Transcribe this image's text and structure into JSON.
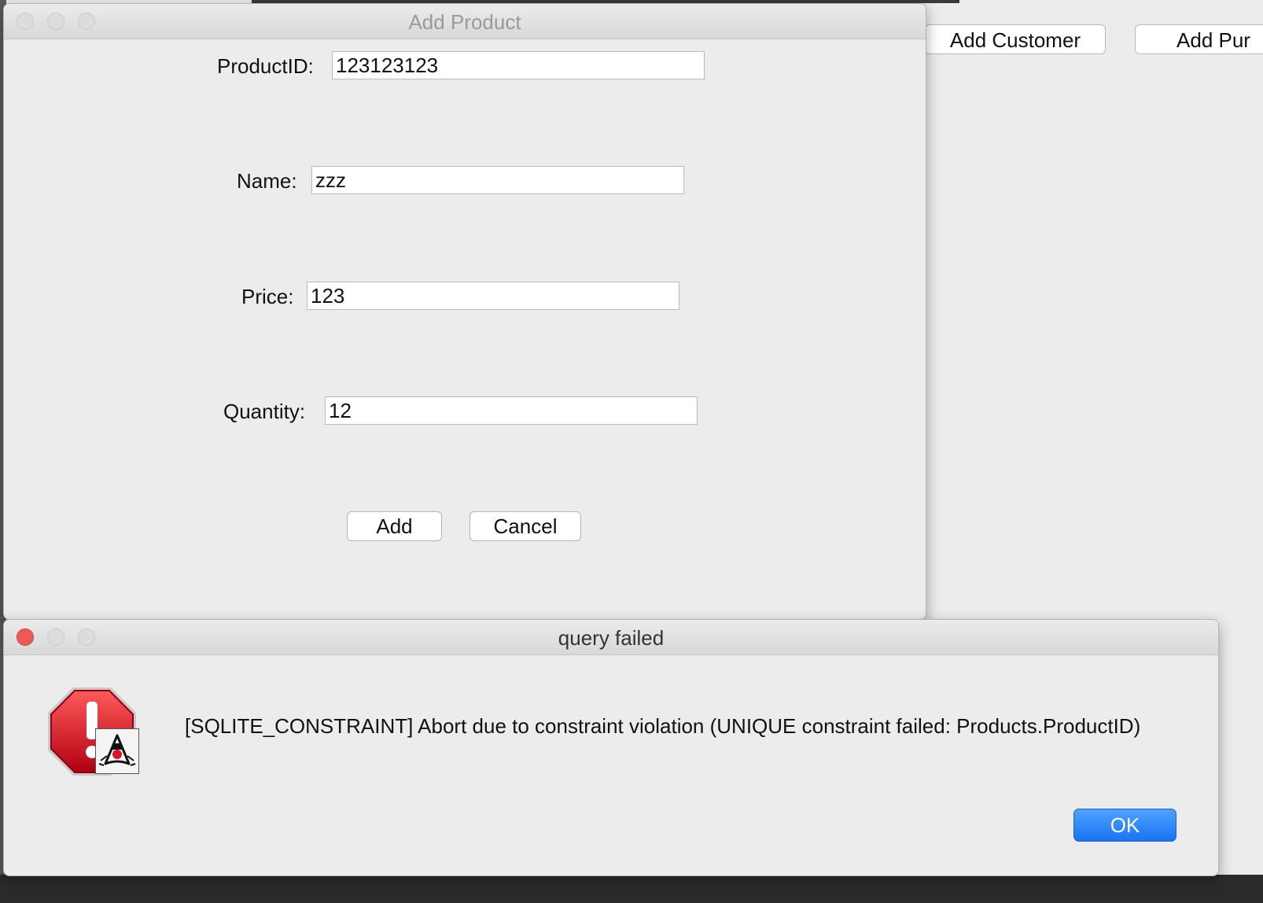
{
  "background_window": {
    "buttons": [
      "Add Customer",
      "Add Pur"
    ]
  },
  "add_product_dialog": {
    "title": "Add Product",
    "fields": [
      {
        "label": "ProductID:",
        "value": "123123123"
      },
      {
        "label": "Name:",
        "value": "zzz"
      },
      {
        "label": "Price:",
        "value": "123"
      },
      {
        "label": "Quantity:",
        "value": "12"
      }
    ],
    "add_label": "Add",
    "cancel_label": "Cancel"
  },
  "error_dialog": {
    "title": "query failed",
    "message": "[SQLITE_CONSTRAINT]  Abort due to constraint violation (UNIQUE constraint failed: Products.ProductID)",
    "ok_label": "OK",
    "icon": "stop-error-icon with java-duke-badge-icon",
    "colors": {
      "ok_button": "#1a73f2",
      "stop_sign": "#d0021b"
    }
  }
}
